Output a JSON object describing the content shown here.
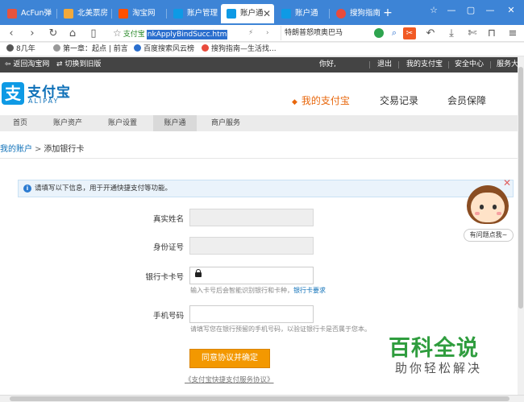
{
  "browser": {
    "tabs": [
      {
        "label": "AcFun弹",
        "fav_color": "#e5543f",
        "active": false
      },
      {
        "label": "北美票房",
        "fav_color": "#f2a93b",
        "active": false
      },
      {
        "label": "淘宝网",
        "fav_color": "#ff5000",
        "active": false
      },
      {
        "label": "账户管理",
        "fav_color": "#0e9ae5",
        "active": false
      },
      {
        "label": "账户通",
        "fav_color": "#0e9ae5",
        "active": true
      },
      {
        "label": "账户通",
        "fav_color": "#0e9ae5",
        "active": false
      },
      {
        "label": "搜狗指南",
        "fav_color": "#e94b3c",
        "active": false
      }
    ],
    "new_tab_symbol": "+",
    "window_controls": [
      "☆",
      "—",
      "▢",
      "—",
      "✕"
    ],
    "address": {
      "site": "支付宝",
      "selected_url": "nkApplyBindSucc.htm"
    },
    "search_text": "特朗普怒喷奥巴马",
    "bookmarks": [
      {
        "label": "8几年",
        "icon_color": "#555555"
      },
      {
        "label": "第一章：起点 | 前言",
        "icon_color": "#999999"
      },
      {
        "label": "百度搜索风云榜",
        "icon_color": "#2b6fce"
      },
      {
        "label": "搜狗指南—生活找...",
        "icon_color": "#e94b3c"
      }
    ]
  },
  "topbar": {
    "back_taobao": "返回淘宝网",
    "switch_old": "切换到旧版",
    "greeting": "你好,",
    "logout": "退出",
    "my_alipay": "我的支付宝",
    "security": "安全中心",
    "service": "服务大"
  },
  "header": {
    "logo_name": "支付宝",
    "logo_sub": "ALIPAY",
    "nav": {
      "my_alipay": "我的支付宝",
      "transactions": "交易记录",
      "member": "会员保障"
    }
  },
  "subnav": [
    "首页",
    "账户资产",
    "账户设置",
    "账户通",
    "商户服务"
  ],
  "breadcrumb": {
    "link": "我的账户",
    "sep": ">",
    "current": "添加银行卡"
  },
  "notice": "请填写以下信息，用于开通快捷支付等功能。",
  "form": {
    "name_label": "真实姓名",
    "id_label": "身份证号",
    "card_label": "银行卡卡号",
    "card_hint": "输入卡号后会智能识别银行和卡种，",
    "card_hint_link": "银行卡要求",
    "phone_label": "手机号码",
    "phone_hint": "请填写您在银行预留的手机号码，以验证银行卡是否属于您本。",
    "submit": "同意协议并确定",
    "agreement": "《支付宝快捷支付服务协议》"
  },
  "help_bubble": "有问题点我~",
  "watermark": {
    "big": "百科全说",
    "small": "助你轻松解决"
  }
}
